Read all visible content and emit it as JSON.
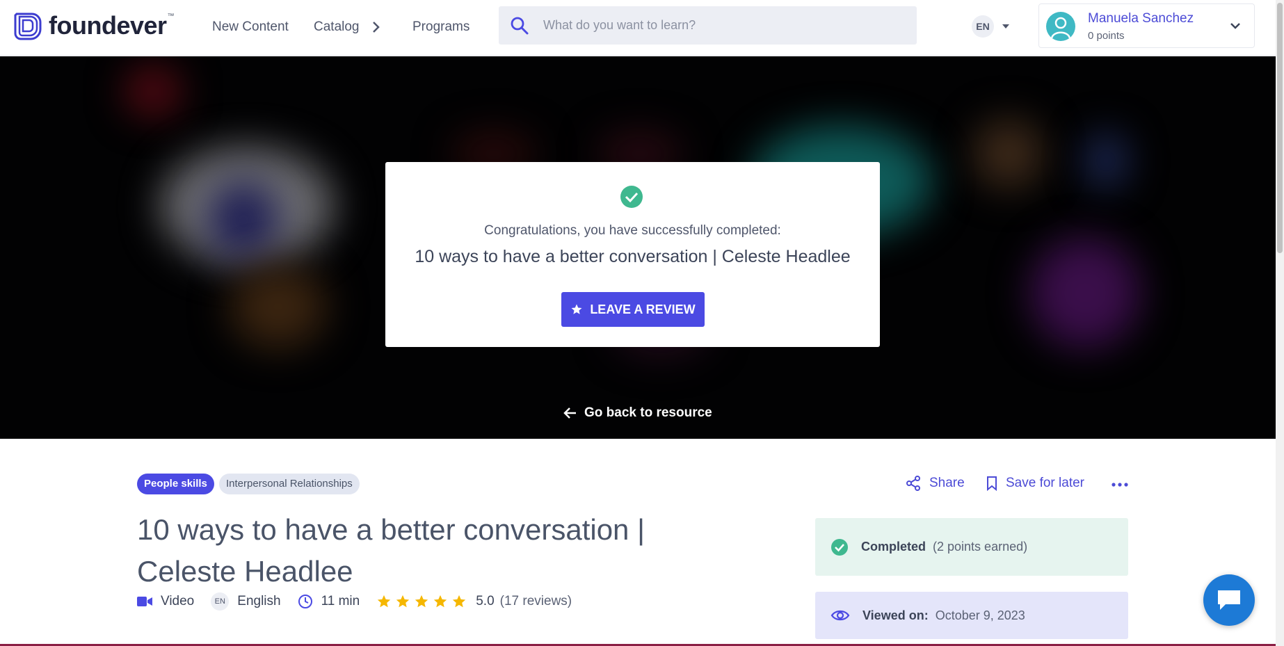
{
  "header": {
    "logo_text": "foundever",
    "logo_tm": "™",
    "nav": {
      "new_content": "New Content",
      "catalog": "Catalog",
      "programs": "Programs"
    },
    "search": {
      "placeholder": "What do you want to learn?"
    },
    "language": "EN",
    "user": {
      "name": "Manuela Sanchez",
      "points": "0 points"
    }
  },
  "hero": {
    "congrats_text": "Congratulations, you have successfully completed:",
    "course_title": "10 ways to have a better conversation | Celeste Headlee",
    "review_button": "LEAVE A REVIEW",
    "go_back": "Go back to resource"
  },
  "content": {
    "tags": [
      "People skills",
      "Interpersonal Relationships"
    ],
    "actions": {
      "share": "Share",
      "save": "Save for later"
    },
    "title": "10 ways to have a better conversation | Celeste Headlee",
    "meta": {
      "type": "Video",
      "language_code": "EN",
      "language": "English",
      "duration": "11 min",
      "rating": "5.0",
      "rating_stars": 5,
      "reviews": "(17 reviews)"
    },
    "status": {
      "completed_label": "Completed",
      "completed_extra": "(2 points earned)",
      "viewed_label": "Viewed on:",
      "viewed_date": "October 9, 2023"
    }
  },
  "colors": {
    "brand": "#4b4ae3",
    "success": "#3fb88f",
    "star": "#f5b700",
    "chat": "#1d7ad6"
  },
  "icons": [
    "logo-icon",
    "search-icon",
    "chevron-right-icon",
    "chevron-down-icon",
    "avatar-icon",
    "check-circle-icon",
    "star-icon",
    "arrow-left-icon",
    "share-icon",
    "bookmark-icon",
    "more-icon",
    "video-icon",
    "clock-icon",
    "eye-icon",
    "chat-icon"
  ]
}
